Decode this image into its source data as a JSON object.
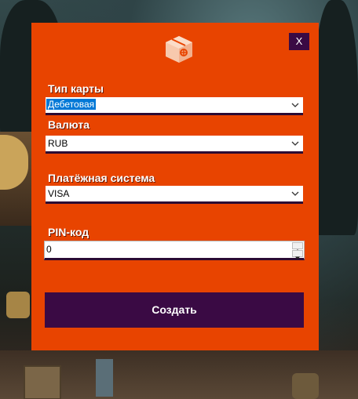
{
  "dialog": {
    "close_label": "X",
    "logo_icon": "package-box-icon",
    "card_type": {
      "label": "Тип карты",
      "value": "Дебетовая"
    },
    "currency": {
      "label": "Валюта",
      "value": "RUB"
    },
    "payment_system": {
      "label": "Платёжная система",
      "value": "VISA"
    },
    "pin": {
      "label": "PIN-код",
      "value": "0"
    },
    "create_label": "Создать"
  },
  "colors": {
    "panel": "#e84400",
    "accent": "#3a0a44",
    "selection": "#0078d7"
  }
}
